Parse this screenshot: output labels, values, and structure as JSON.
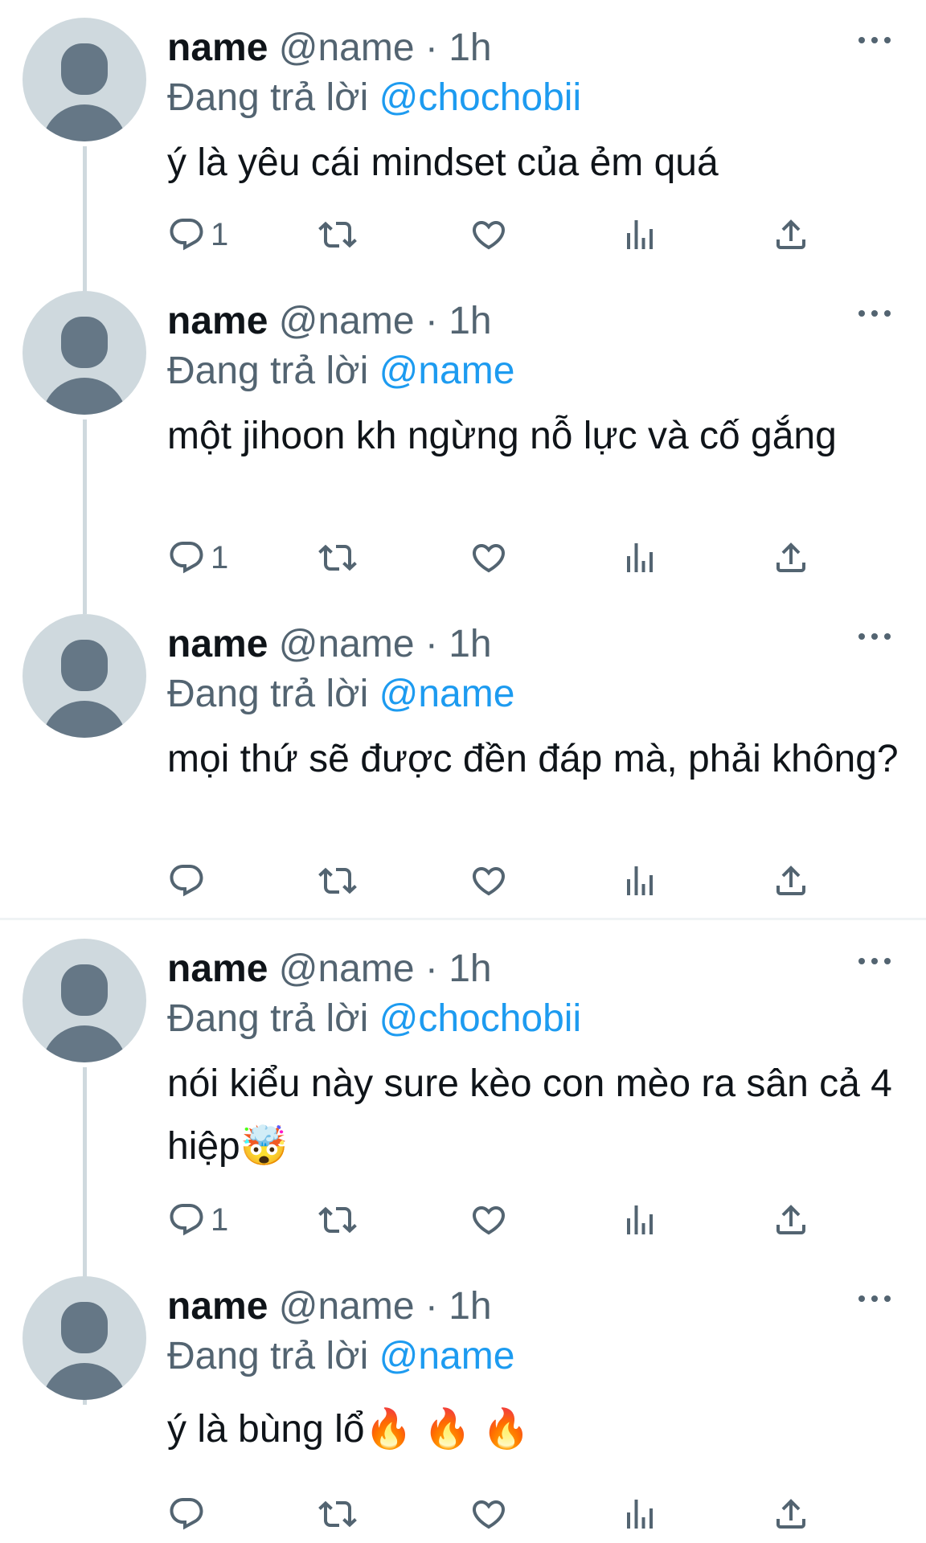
{
  "tweets": [
    {
      "name": "name",
      "handle": "@name",
      "dot": "·",
      "time": "1h",
      "replying_prefix": "Đang trả lời",
      "replying_to": "@chochobii",
      "text": "ý là yêu cái mindset của ẻm quá",
      "reply_count": "1"
    },
    {
      "name": "name",
      "handle": "@name",
      "dot": "·",
      "time": "1h",
      "replying_prefix": "Đang trả lời",
      "replying_to": "@name",
      "text": "một jihoon kh ngừng nỗ lực và cố gắng",
      "reply_count": "1"
    },
    {
      "name": "name",
      "handle": "@name",
      "dot": "·",
      "time": "1h",
      "replying_prefix": "Đang trả lời",
      "replying_to": "@name",
      "text": "mọi thứ sẽ được đền đáp mà, phải không?",
      "reply_count": ""
    },
    {
      "name": "name",
      "handle": "@name",
      "dot": "·",
      "time": "1h",
      "replying_prefix": "Đang trả lời",
      "replying_to": "@chochobii",
      "text": "nói kiểu này sure kèo con mèo ra sân cả 4 hiệp🤯",
      "reply_count": "1"
    },
    {
      "name": "name",
      "handle": "@name",
      "dot": "·",
      "time": "1h",
      "replying_prefix": "Đang trả lời",
      "replying_to": "@name",
      "text": "ý là bùng lổ🔥 🔥 🔥",
      "reply_count": ""
    }
  ],
  "icons": {
    "reply": "reply-icon",
    "retweet": "retweet-icon",
    "like": "heart-icon",
    "views": "views-icon",
    "share": "share-icon",
    "more": "more-icon"
  },
  "colors": {
    "text": "#0f1419",
    "secondary": "#536471",
    "link": "#1d9bf0",
    "avatar_bg": "#cfd9de",
    "avatar_fg": "#657786"
  }
}
